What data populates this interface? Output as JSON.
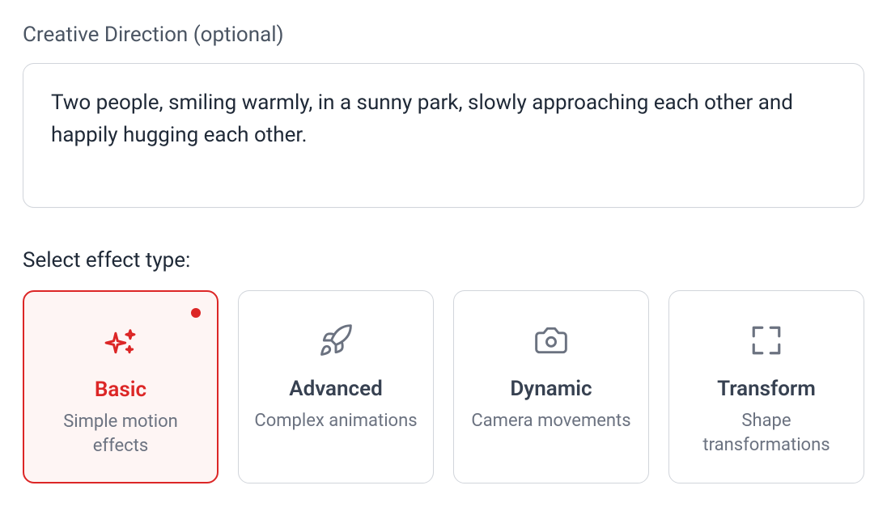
{
  "creative_direction": {
    "label": "Creative Direction (optional)",
    "value": "Two people, smiling warmly, in a sunny park, slowly approaching each other and happily hugging each other."
  },
  "effect_section": {
    "label": "Select effect type:"
  },
  "effects": [
    {
      "title": "Basic",
      "desc": "Simple motion effects",
      "selected": true,
      "icon": "sparkles-icon"
    },
    {
      "title": "Advanced",
      "desc": "Complex animations",
      "selected": false,
      "icon": "rocket-icon"
    },
    {
      "title": "Dynamic",
      "desc": "Camera movements",
      "selected": false,
      "icon": "camera-icon"
    },
    {
      "title": "Transform",
      "desc": "Shape transformations",
      "selected": false,
      "icon": "expand-icon"
    }
  ]
}
